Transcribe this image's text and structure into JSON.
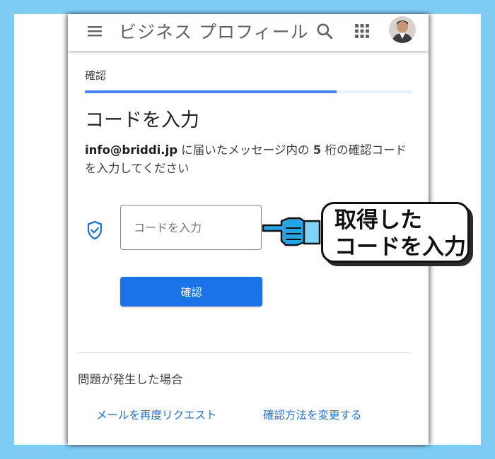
{
  "app": {
    "title": "ビジネス プロフィール"
  },
  "step": {
    "label": "確認",
    "progress": 0.77
  },
  "main": {
    "heading": "コードを入力",
    "description": {
      "email": "info@briddi.jp",
      "text_before_digits": " に届いたメッセージ内の ",
      "digits": "5",
      "text_after_digits": " 桁の確認コードを入力してください"
    },
    "input": {
      "placeholder": "コードを入力",
      "value": ""
    },
    "confirm_label": "確認"
  },
  "help": {
    "title": "問題が発生した場合",
    "resend_link": "メールを再度リクエスト",
    "change_method_link": "確認方法を変更する"
  },
  "callout": {
    "line1": "取得した",
    "line2": "コードを入力"
  },
  "icons": {
    "menu": "menu-icon",
    "search": "search-icon",
    "apps": "apps-icon",
    "shield": "shield-check-icon",
    "hand": "pointing-hand-icon"
  },
  "colors": {
    "accent": "#1a73e8",
    "progress": "#4285f4",
    "progress_track": "#e8f0fe",
    "background": "#7ecbf3",
    "text": "#202124"
  }
}
